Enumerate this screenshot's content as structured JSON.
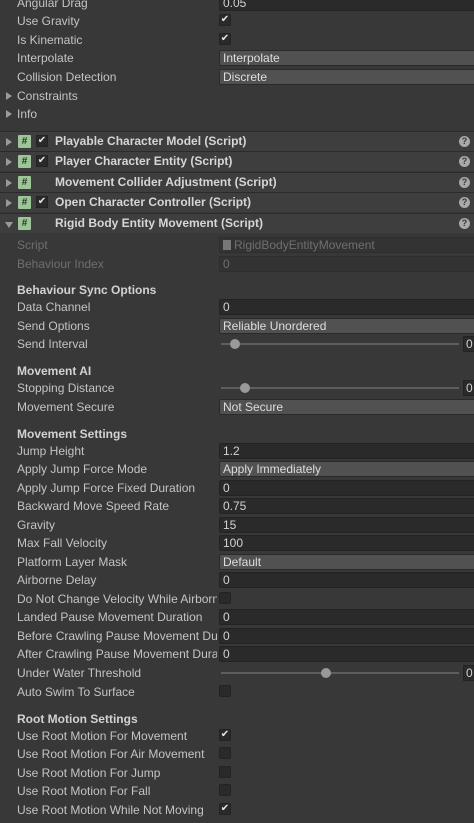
{
  "top": {
    "angular_drag": {
      "label": "Angular Drag",
      "value": "0.05"
    },
    "use_gravity": {
      "label": "Use Gravity",
      "checked": true
    },
    "is_kinematic": {
      "label": "Is Kinematic",
      "checked": true
    },
    "interpolate": {
      "label": "Interpolate",
      "value": "Interpolate"
    },
    "collision_detection": {
      "label": "Collision Detection",
      "value": "Discrete"
    },
    "constraints": {
      "label": "Constraints"
    },
    "info": {
      "label": "Info"
    }
  },
  "components": [
    {
      "title": "Playable Character Model (Script)",
      "has_check": true
    },
    {
      "title": "Player Character Entity (Script)",
      "has_check": true
    },
    {
      "title": "Movement Collider Adjustment (Script)",
      "has_check": false
    },
    {
      "title": "Open Character Controller (Script)",
      "has_check": true
    },
    {
      "title": "Rigid Body Entity Movement (Script)",
      "has_check": false
    }
  ],
  "icons": {
    "script": "script-hash-icon",
    "help": "help-icon",
    "check": "✔",
    "hash": "#",
    "help_glyph": "?"
  },
  "script": {
    "label": "Script",
    "value": "RigidBodyEntityMovement"
  },
  "behaviour_index": {
    "label": "Behaviour Index",
    "value": "0"
  },
  "sync": {
    "header": "Behaviour Sync Options",
    "data_channel": {
      "label": "Data Channel",
      "value": "0"
    },
    "send_options": {
      "label": "Send Options",
      "value": "Reliable Unordered"
    },
    "send_interval": {
      "label": "Send Interval",
      "value": "0",
      "slider_fraction": 0.06
    }
  },
  "ai": {
    "header": "Movement AI",
    "stopping_distance": {
      "label": "Stopping Distance",
      "value": "0",
      "slider_fraction": 0.1
    },
    "movement_secure": {
      "label": "Movement Secure",
      "value": "Not Secure"
    }
  },
  "movement": {
    "header": "Movement Settings",
    "jump_height": {
      "label": "Jump Height",
      "value": "1.2"
    },
    "apply_jump_force_mode": {
      "label": "Apply Jump Force Mode",
      "value": "Apply Immediately"
    },
    "apply_jump_force_fixed_duration": {
      "label": "Apply Jump Force Fixed Duration",
      "value": "0"
    },
    "backward_move_speed_rate": {
      "label": "Backward Move Speed Rate",
      "value": "0.75"
    },
    "gravity": {
      "label": "Gravity",
      "value": "15"
    },
    "max_fall_velocity": {
      "label": "Max Fall Velocity",
      "value": "100"
    },
    "platform_layer_mask": {
      "label": "Platform Layer Mask",
      "value": "Default"
    },
    "airborne_delay": {
      "label": "Airborne Delay",
      "value": "0"
    },
    "do_not_change_velocity": {
      "label": "Do Not Change Velocity While Airborne",
      "checked": false
    },
    "landed_pause": {
      "label": "Landed Pause Movement Duration",
      "value": "0"
    },
    "before_crawling": {
      "label": "Before Crawling Pause Movement Duration",
      "value": "0"
    },
    "after_crawling": {
      "label": "After Crawling Pause Movement Duration",
      "value": "0"
    },
    "under_water_threshold": {
      "label": "Under Water Threshold",
      "value": "0",
      "slider_fraction": 0.44
    },
    "auto_swim": {
      "label": "Auto Swim To Surface",
      "checked": false
    }
  },
  "root_motion": {
    "header": "Root Motion Settings",
    "for_movement": {
      "label": "Use Root Motion For Movement",
      "checked": true
    },
    "for_air_movement": {
      "label": "Use Root Motion For Air Movement",
      "checked": false
    },
    "for_jump": {
      "label": "Use Root Motion For Jump",
      "checked": false
    },
    "for_fall": {
      "label": "Use Root Motion For Fall",
      "checked": false
    },
    "while_not_moving": {
      "label": "Use Root Motion While Not Moving",
      "checked": true
    }
  }
}
